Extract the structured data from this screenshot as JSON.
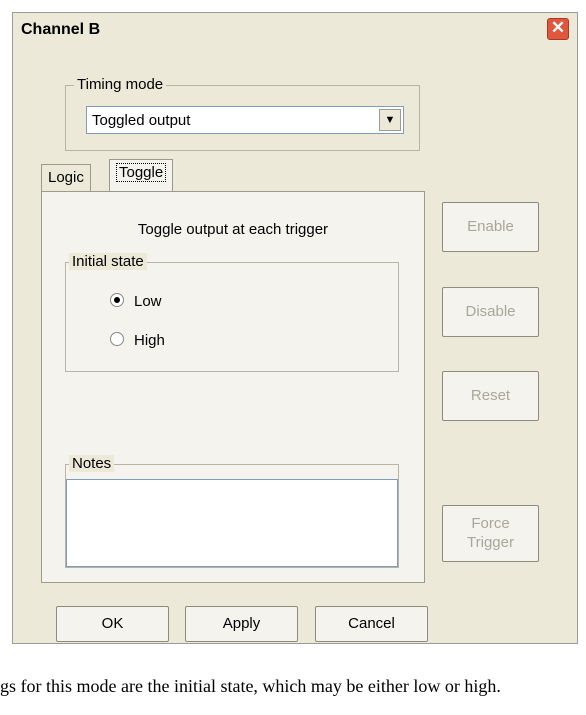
{
  "window": {
    "title": "Channel B",
    "close_icon": "close-icon"
  },
  "timing_mode": {
    "label": "Timing mode",
    "selected": "Toggled output"
  },
  "tabs": [
    {
      "label": "Logic"
    },
    {
      "label": "Toggle"
    }
  ],
  "toggle_panel": {
    "description": "Toggle output at each trigger",
    "initial_state": {
      "label": "Initial state",
      "options": [
        {
          "label": "Low",
          "checked": true
        },
        {
          "label": "High",
          "checked": false
        }
      ]
    },
    "notes": {
      "label": "Notes",
      "value": ""
    }
  },
  "side_buttons": {
    "enable": "Enable",
    "disable": "Disable",
    "reset": "Reset",
    "force_line1": "Force",
    "force_line2": "Trigger"
  },
  "footer_buttons": {
    "ok": "OK",
    "apply": "Apply",
    "cancel": "Cancel"
  },
  "caption": "gs for this mode are the initial state, which may be either low or high."
}
